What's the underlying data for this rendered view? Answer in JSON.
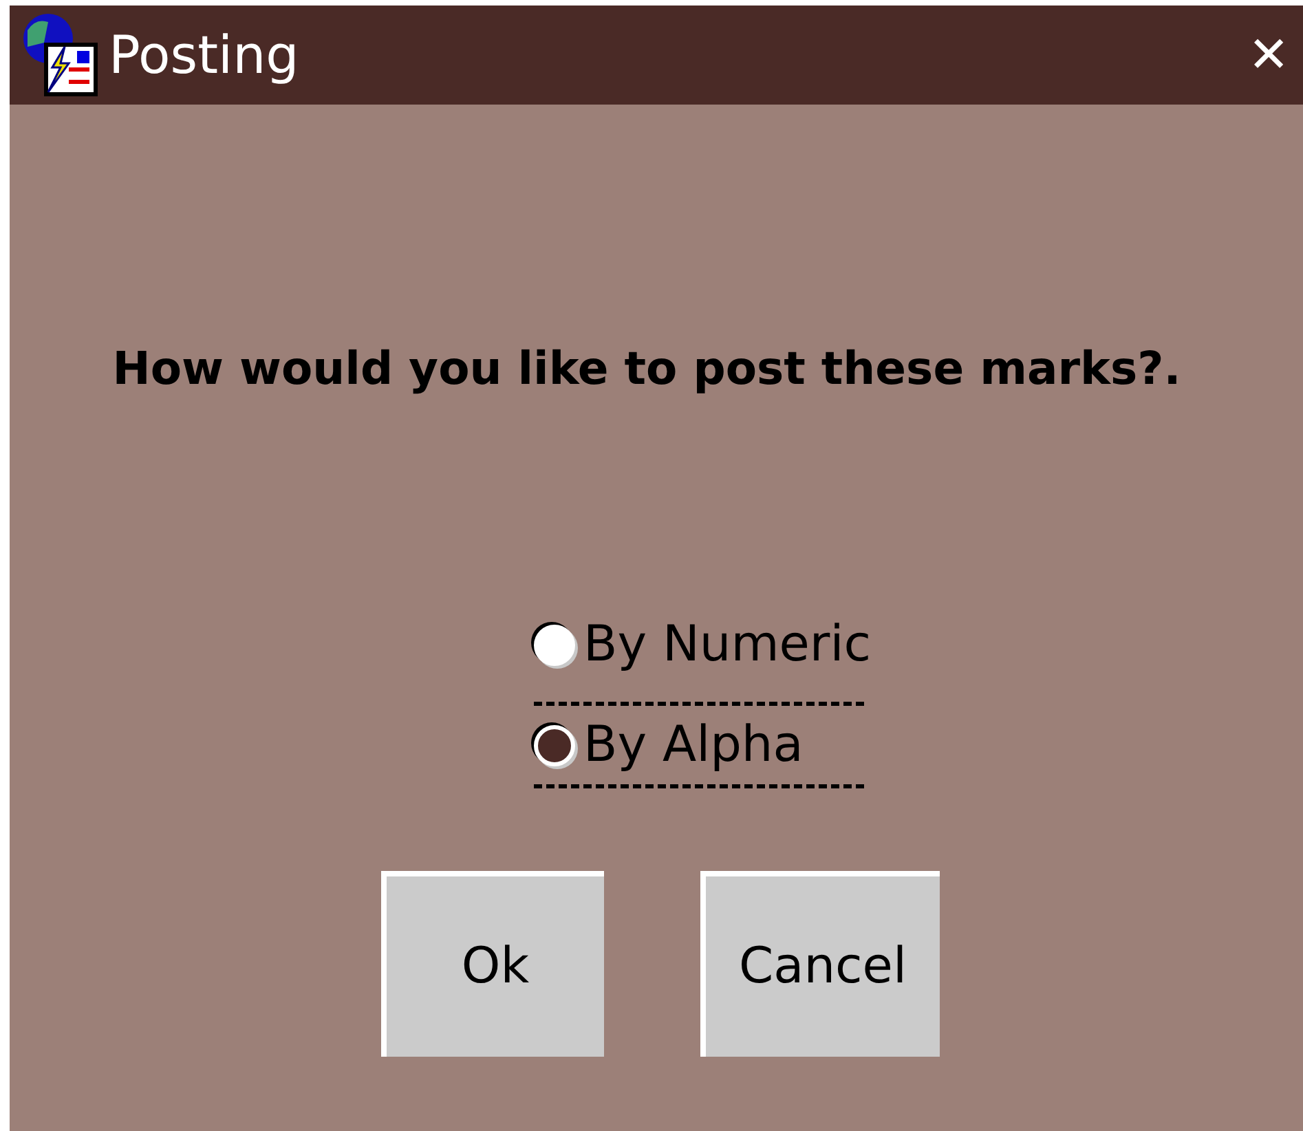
{
  "window": {
    "title": "Posting",
    "close": "✕"
  },
  "question": "How would you like to post these marks?.",
  "options": [
    {
      "label": "By Numeric",
      "selected": false
    },
    {
      "label": "By Alpha",
      "selected": true
    }
  ],
  "buttons": [
    {
      "label": "Ok"
    },
    {
      "label": "Cancel"
    }
  ]
}
